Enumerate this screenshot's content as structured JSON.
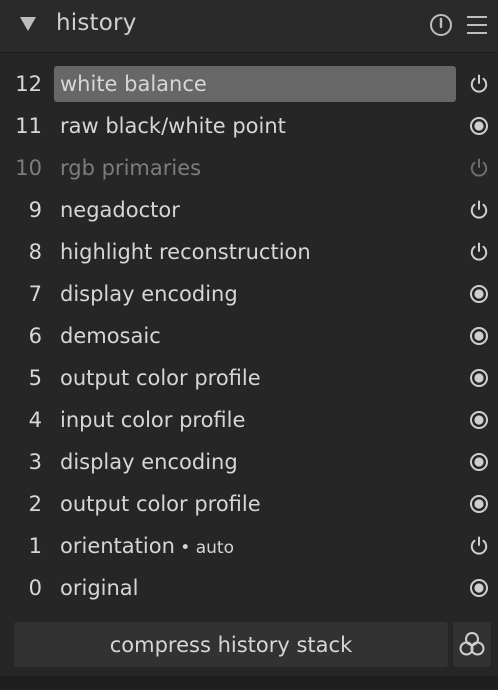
{
  "header": {
    "title": "history",
    "collapse_icon": "triangle-down-icon",
    "reset_icon": "reset-circle-icon",
    "presets_icon": "hamburger-menu-icon"
  },
  "history": {
    "items": [
      {
        "num": "12",
        "label": "white balance",
        "suffix": "",
        "state": "off",
        "selected": true,
        "disabled": false
      },
      {
        "num": "11",
        "label": "raw black/white point",
        "suffix": "",
        "state": "on",
        "selected": false,
        "disabled": false
      },
      {
        "num": "10",
        "label": "rgb primaries",
        "suffix": "",
        "state": "off",
        "selected": false,
        "disabled": true
      },
      {
        "num": "9",
        "label": "negadoctor",
        "suffix": "",
        "state": "off",
        "selected": false,
        "disabled": false
      },
      {
        "num": "8",
        "label": "highlight reconstruction",
        "suffix": "",
        "state": "off",
        "selected": false,
        "disabled": false
      },
      {
        "num": "7",
        "label": "display encoding",
        "suffix": "",
        "state": "on",
        "selected": false,
        "disabled": false
      },
      {
        "num": "6",
        "label": "demosaic",
        "suffix": "",
        "state": "on",
        "selected": false,
        "disabled": false
      },
      {
        "num": "5",
        "label": "output color profile",
        "suffix": "",
        "state": "on",
        "selected": false,
        "disabled": false
      },
      {
        "num": "4",
        "label": "input color profile",
        "suffix": "",
        "state": "on",
        "selected": false,
        "disabled": false
      },
      {
        "num": "3",
        "label": "display encoding",
        "suffix": "",
        "state": "on",
        "selected": false,
        "disabled": false
      },
      {
        "num": "2",
        "label": "output color profile",
        "suffix": "",
        "state": "on",
        "selected": false,
        "disabled": false
      },
      {
        "num": "1",
        "label": "orientation",
        "suffix": " • auto",
        "state": "off",
        "selected": false,
        "disabled": false
      },
      {
        "num": "0",
        "label": "original",
        "suffix": "",
        "state": "on",
        "selected": false,
        "disabled": false
      }
    ]
  },
  "footer": {
    "compress_label": "compress history stack",
    "style_icon": "create-style-icon"
  },
  "colors": {
    "background": "#262626",
    "selected_row": "#676767",
    "text": "#d6d6d6",
    "disabled_text": "#7d7d7d",
    "button_bg": "#323232"
  }
}
